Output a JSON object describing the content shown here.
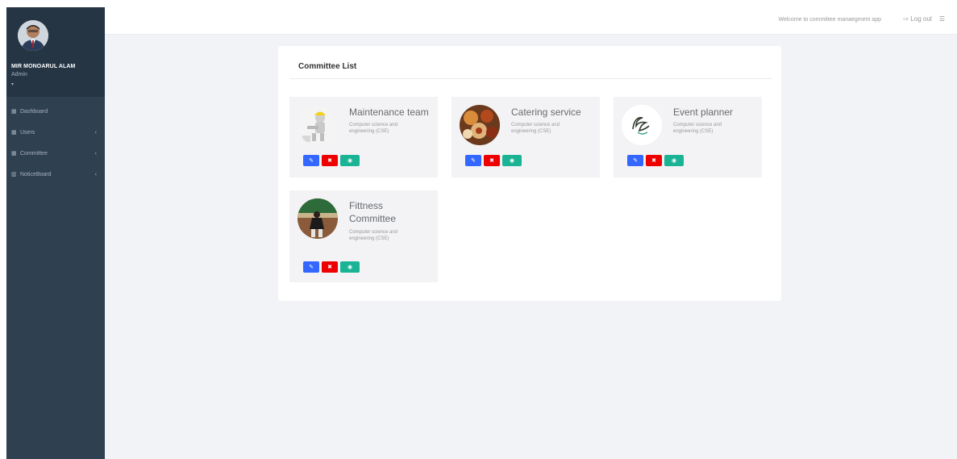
{
  "sidebar": {
    "profile": {
      "name": "MIR MONOARUL ALAM",
      "role": "Admin",
      "caret": "▾"
    },
    "items": [
      {
        "icon": "grid-icon",
        "glyph": "▦",
        "label": "Dashboard",
        "has_arrow": false
      },
      {
        "icon": "grid-icon",
        "glyph": "▦",
        "label": "Users",
        "has_arrow": true
      },
      {
        "icon": "grid-icon",
        "glyph": "▦",
        "label": "Committee",
        "has_arrow": true
      },
      {
        "icon": "bar-chart-icon",
        "glyph": "▥",
        "label": "NoticeBoard",
        "has_arrow": true
      }
    ],
    "arrow_glyph": "‹"
  },
  "topbar": {
    "welcome": "Welcome to committee manaegment app",
    "logout_label": "Log out",
    "logout_glyph": "⇨",
    "menu_glyph": "☰"
  },
  "panel": {
    "title": "Committee List",
    "cards": [
      {
        "title": "Maintenance team",
        "subtitle": "Computer science and engineering (CSE)"
      },
      {
        "title": "Catering service",
        "subtitle": "Computer science and engineering (CSE)"
      },
      {
        "title": "Event planner",
        "subtitle": "Computer science and engineering (CSE)"
      },
      {
        "title": "Fittness Committee",
        "subtitle": "Computer science and engineering (CSE)"
      }
    ],
    "buttons": {
      "edit_glyph": "✎",
      "delete_glyph": "✖",
      "view_glyph": "◉"
    }
  },
  "colors": {
    "sidebar": "#2f4050",
    "edit": "#3367ff",
    "delete": "#ee0000",
    "view": "#1ab394"
  }
}
